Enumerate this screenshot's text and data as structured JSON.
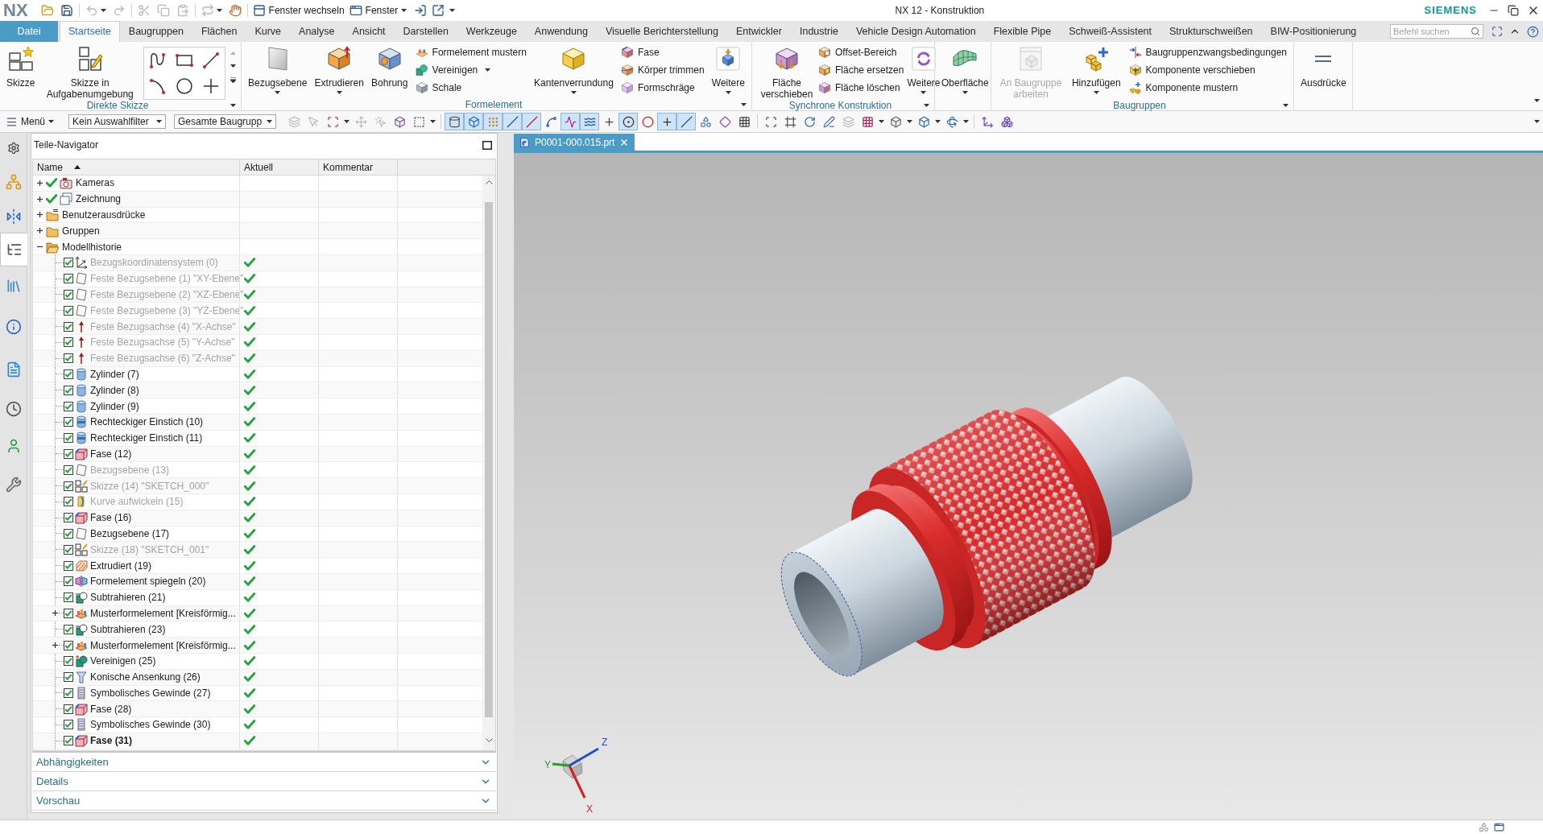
{
  "title_bar": {
    "logo": "NX",
    "quick_access": [
      {
        "disabled": false,
        "dropdown": false
      },
      {
        "disabled": false,
        "dropdown": false
      },
      {
        "disabled": true,
        "dropdown": true
      },
      {
        "disabled": true,
        "dropdown": false
      },
      {
        "disabled": true,
        "dropdown": false
      },
      {
        "disabled": true,
        "dropdown": false
      },
      {
        "disabled": true,
        "dropdown": false
      },
      {
        "disabled": true,
        "dropdown": true
      },
      {
        "disabled": false,
        "dropdown": false
      }
    ],
    "window_commands": [
      {
        "label": "Fenster wechseln",
        "dropdown": false
      },
      {
        "label": "Fenster",
        "dropdown": true
      }
    ],
    "title": "NX 12 - Konstruktion",
    "brand": "SIEMENS"
  },
  "menu_tabs": [
    {
      "label": "Datei",
      "kind": "file",
      "selected": false
    },
    {
      "label": "Startseite",
      "kind": "tab",
      "selected": true
    },
    {
      "label": "Baugruppen",
      "kind": "tab",
      "selected": false
    },
    {
      "label": "Flächen",
      "kind": "tab",
      "selected": false
    },
    {
      "label": "Kurve",
      "kind": "tab",
      "selected": false
    },
    {
      "label": "Analyse",
      "kind": "tab",
      "selected": false
    },
    {
      "label": "Ansicht",
      "kind": "tab",
      "selected": false
    },
    {
      "label": "Darstellen",
      "kind": "tab",
      "selected": false
    },
    {
      "label": "Werkzeuge",
      "kind": "tab",
      "selected": false
    },
    {
      "label": "Anwendung",
      "kind": "tab",
      "selected": false
    },
    {
      "label": "Visuelle Berichterstellung",
      "kind": "tab",
      "selected": false
    },
    {
      "label": "Entwickler",
      "kind": "tab",
      "selected": false
    },
    {
      "label": "Industrie",
      "kind": "tab",
      "selected": false
    },
    {
      "label": "Vehicle Design Automation",
      "kind": "tab",
      "selected": false
    },
    {
      "label": "Flexible Pipe",
      "kind": "tab",
      "selected": false
    },
    {
      "label": "Schweiß-Assistent",
      "kind": "tab",
      "selected": false
    },
    {
      "label": "Strukturschweißen",
      "kind": "tab",
      "selected": false
    },
    {
      "label": "BIW-Positionierung",
      "kind": "tab",
      "selected": false
    }
  ],
  "command_search": {
    "placeholder": "Befehl suchen"
  },
  "ribbon": {
    "groups": [
      {
        "label": "Direkte Skizze",
        "launcher": true,
        "items": [
          {
            "kind": "large",
            "label": "Skizze",
            "dropdown": false,
            "disabled": false
          },
          {
            "kind": "large",
            "label": "Skizze in Aufgabenumgebung",
            "dropdown": false,
            "disabled": false
          },
          {
            "kind": "gallery"
          }
        ]
      },
      {
        "label": "Formelement",
        "launcher": true,
        "items": [
          {
            "kind": "large",
            "label": "Bezugsebene",
            "dropdown": true,
            "disabled": false
          },
          {
            "kind": "large",
            "label": "Extrudieren",
            "dropdown": true,
            "disabled": false
          },
          {
            "kind": "large",
            "label": "Bohrung",
            "dropdown": false,
            "disabled": false
          },
          {
            "kind": "stack",
            "items": [
              {
                "label": "Formelement mustern",
                "dropdown": false
              },
              {
                "label": "Vereinigen",
                "dropdown": true
              },
              {
                "label": "Schale",
                "dropdown": false
              }
            ]
          },
          {
            "kind": "large",
            "label": "Kantenverrundung",
            "dropdown": true,
            "disabled": false
          },
          {
            "kind": "stack",
            "items": [
              {
                "label": "Fase",
                "dropdown": false
              },
              {
                "label": "Körper trimmen",
                "dropdown": false
              },
              {
                "label": "Formschräge",
                "dropdown": false
              }
            ]
          },
          {
            "kind": "large",
            "label": "Weitere",
            "dropdown": true,
            "disabled": false
          }
        ]
      },
      {
        "label": "Synchrone Konstruktion",
        "launcher": true,
        "items": [
          {
            "kind": "large",
            "label": "Fläche verschieben",
            "dropdown": false,
            "disabled": false
          },
          {
            "kind": "stack",
            "items": [
              {
                "label": "Offset-Bereich",
                "dropdown": false
              },
              {
                "label": "Fläche ersetzen",
                "dropdown": false
              },
              {
                "label": "Fläche löschen",
                "dropdown": false
              }
            ]
          },
          {
            "kind": "large",
            "label": "Weitere",
            "dropdown": true,
            "disabled": false
          }
        ]
      },
      {
        "launcher": false,
        "items": [
          {
            "kind": "large",
            "label": "Oberfläche",
            "dropdown": true,
            "disabled": false
          }
        ]
      },
      {
        "label": "Baugruppen",
        "launcher": true,
        "items": [
          {
            "kind": "large",
            "label": "An Baugruppe arbeiten",
            "dropdown": false,
            "disabled": true
          },
          {
            "kind": "large",
            "label": "Hinzufügen",
            "dropdown": true,
            "disabled": false
          },
          {
            "kind": "stack",
            "items": [
              {
                "label": "Baugruppenzwangsbedingungen",
                "dropdown": false
              },
              {
                "label": "Komponente verschieben",
                "dropdown": false
              },
              {
                "label": "Komponente mustern",
                "dropdown": false
              }
            ]
          }
        ]
      },
      {
        "launcher": false,
        "items": [
          {
            "kind": "large",
            "label": "Ausdrücke",
            "dropdown": false,
            "disabled": false
          }
        ]
      }
    ]
  },
  "toolbar": {
    "menu_label": "Menü",
    "filters": [
      "Kein Auswahlfilter",
      "Gesamte Baugrupp"
    ],
    "tools": [
      {
        "pressed": false,
        "disabled": true,
        "dropdown": false
      },
      {
        "pressed": false,
        "disabled": true,
        "dropdown": false
      },
      {
        "pressed": false,
        "disabled": false,
        "dropdown": true
      },
      {
        "pressed": false,
        "disabled": true,
        "dropdown": false
      },
      {
        "pressed": false,
        "disabled": true,
        "dropdown": false
      },
      {
        "pressed": false,
        "disabled": false,
        "dropdown": false
      },
      {
        "pressed": false,
        "disabled": false,
        "dropdown": true
      },
      {
        "pressed": true,
        "disabled": false,
        "dropdown": false
      },
      {
        "pressed": true,
        "disabled": false,
        "dropdown": false
      },
      {
        "pressed": true,
        "disabled": false,
        "dropdown": false
      },
      {
        "pressed": true,
        "disabled": false,
        "dropdown": false
      },
      {
        "pressed": true,
        "disabled": false,
        "dropdown": false
      },
      {
        "pressed": false,
        "disabled": false,
        "dropdown": false
      },
      {
        "pressed": true,
        "disabled": false,
        "dropdown": false
      },
      {
        "pressed": true,
        "disabled": false,
        "dropdown": false
      },
      {
        "pressed": false,
        "disabled": false,
        "dropdown": false
      },
      {
        "pressed": true,
        "disabled": false,
        "dropdown": false
      },
      {
        "pressed": false,
        "disabled": false,
        "dropdown": false
      },
      {
        "pressed": true,
        "disabled": false,
        "dropdown": false
      },
      {
        "pressed": true,
        "disabled": false,
        "dropdown": false
      },
      {
        "pressed": false,
        "disabled": false,
        "dropdown": false
      },
      {
        "pressed": false,
        "disabled": false,
        "dropdown": false
      },
      {
        "pressed": false,
        "disabled": false,
        "dropdown": false
      },
      {
        "pressed": false,
        "disabled": false,
        "dropdown": false
      },
      {
        "pressed": false,
        "disabled": false,
        "dropdown": false
      },
      {
        "pressed": false,
        "disabled": false,
        "dropdown": false
      },
      {
        "pressed": false,
        "disabled": false,
        "dropdown": false
      },
      {
        "pressed": false,
        "disabled": true,
        "dropdown": false
      },
      {
        "pressed": false,
        "disabled": false,
        "dropdown": true
      },
      {
        "pressed": false,
        "disabled": false,
        "dropdown": true
      },
      {
        "pressed": false,
        "disabled": false,
        "dropdown": true
      },
      {
        "pressed": false,
        "disabled": false,
        "dropdown": true
      },
      {
        "pressed": false,
        "disabled": false,
        "dropdown": false
      },
      {
        "pressed": false,
        "disabled": false,
        "dropdown": false
      }
    ]
  },
  "resource_bar": [
    {
      "selected": false
    },
    {
      "selected": false
    },
    {
      "selected": true
    },
    {
      "selected": false
    },
    {
      "selected": false
    },
    {
      "selected": false
    },
    {
      "selected": false
    },
    {
      "selected": false
    },
    {
      "selected": false
    }
  ],
  "navigator": {
    "title": "Teile-Navigator",
    "columns": [
      {
        "label": "Name",
        "sorted": true
      },
      {
        "label": "Aktuell",
        "sorted": false
      },
      {
        "label": "Kommentar",
        "sorted": false
      }
    ],
    "tree": [
      {
        "label": "Kameras",
        "checked": true,
        "expanded": false
      },
      {
        "label": "Zeichnung",
        "checked": true,
        "expanded": false
      },
      {
        "label": "Benutzerausdrücke",
        "checked": false,
        "expanded": false
      },
      {
        "label": "Gruppen",
        "checked": false,
        "expanded": false
      },
      {
        "label": "Modellhistorie",
        "checked": false,
        "expanded": true,
        "children": [
          {
            "label": "Bezugskoordinatensystem (0)",
            "checked": true,
            "hidden": true,
            "current": false,
            "collapsed": false,
            "up_to_date": true
          },
          {
            "label": "Feste Bezugsebene (1) \"XY-Ebene\"",
            "checked": true,
            "hidden": true,
            "current": false,
            "collapsed": false,
            "up_to_date": true
          },
          {
            "label": "Feste Bezugsebene (2) \"XZ-Ebene\"",
            "checked": true,
            "hidden": true,
            "current": false,
            "collapsed": false,
            "up_to_date": true
          },
          {
            "label": "Feste Bezugsebene (3) \"YZ-Ebene\"",
            "checked": true,
            "hidden": true,
            "current": false,
            "collapsed": false,
            "up_to_date": true
          },
          {
            "label": "Feste Bezugsachse (4) \"X-Achse\"",
            "checked": true,
            "hidden": true,
            "current": false,
            "collapsed": false,
            "up_to_date": true
          },
          {
            "label": "Feste Bezugsachse (5) \"Y-Achse\"",
            "checked": true,
            "hidden": true,
            "current": false,
            "collapsed": false,
            "up_to_date": true
          },
          {
            "label": "Feste Bezugsachse (6) \"Z-Achse\"",
            "checked": true,
            "hidden": true,
            "current": false,
            "collapsed": false,
            "up_to_date": true
          },
          {
            "label": "Zylinder (7)",
            "checked": true,
            "hidden": false,
            "current": false,
            "collapsed": false,
            "up_to_date": true
          },
          {
            "label": "Zylinder (8)",
            "checked": true,
            "hidden": false,
            "current": false,
            "collapsed": false,
            "up_to_date": true
          },
          {
            "label": "Zylinder (9)",
            "checked": true,
            "hidden": false,
            "current": false,
            "collapsed": false,
            "up_to_date": true
          },
          {
            "label": "Rechteckiger Einstich (10)",
            "checked": true,
            "hidden": false,
            "current": false,
            "collapsed": false,
            "up_to_date": true
          },
          {
            "label": "Rechteckiger Einstich (11)",
            "checked": true,
            "hidden": false,
            "current": false,
            "collapsed": false,
            "up_to_date": true
          },
          {
            "label": "Fase (12)",
            "checked": true,
            "hidden": false,
            "current": false,
            "collapsed": false,
            "up_to_date": true
          },
          {
            "label": "Bezugsebene (13)",
            "checked": true,
            "hidden": true,
            "current": false,
            "collapsed": false,
            "up_to_date": true
          },
          {
            "label": "Skizze (14) \"SKETCH_000\"",
            "checked": true,
            "hidden": true,
            "current": false,
            "collapsed": false,
            "up_to_date": true
          },
          {
            "label": "Kurve aufwickeln (15)",
            "checked": true,
            "hidden": true,
            "current": false,
            "collapsed": false,
            "up_to_date": true
          },
          {
            "label": "Fase (16)",
            "checked": true,
            "hidden": false,
            "current": false,
            "collapsed": false,
            "up_to_date": true
          },
          {
            "label": "Bezugsebene (17)",
            "checked": true,
            "hidden": false,
            "current": false,
            "collapsed": false,
            "up_to_date": true
          },
          {
            "label": "Skizze (18) \"SKETCH_001\"",
            "checked": true,
            "hidden": true,
            "current": false,
            "collapsed": false,
            "up_to_date": true
          },
          {
            "label": "Extrudiert (19)",
            "checked": true,
            "hidden": false,
            "current": false,
            "collapsed": false,
            "up_to_date": true
          },
          {
            "label": "Formelement spiegeln (20)",
            "checked": true,
            "hidden": false,
            "current": false,
            "collapsed": false,
            "up_to_date": true
          },
          {
            "label": "Subtrahieren (21)",
            "checked": true,
            "hidden": false,
            "current": false,
            "collapsed": false,
            "up_to_date": true
          },
          {
            "label": "Musterformelement [Kreisförmig...",
            "checked": true,
            "hidden": false,
            "current": false,
            "collapsed": true,
            "up_to_date": true
          },
          {
            "label": "Subtrahieren (23)",
            "checked": true,
            "hidden": false,
            "current": false,
            "collapsed": false,
            "up_to_date": true
          },
          {
            "label": "Musterformelement [Kreisförmig...",
            "checked": true,
            "hidden": false,
            "current": false,
            "collapsed": true,
            "up_to_date": true
          },
          {
            "label": "Vereinigen (25)",
            "checked": true,
            "hidden": false,
            "current": false,
            "collapsed": false,
            "up_to_date": true
          },
          {
            "label": "Konische Ansenkung (26)",
            "checked": true,
            "hidden": false,
            "current": false,
            "collapsed": false,
            "up_to_date": true
          },
          {
            "label": "Symbolisches Gewinde (27)",
            "checked": true,
            "hidden": false,
            "current": false,
            "collapsed": false,
            "up_to_date": true
          },
          {
            "label": "Fase (28)",
            "checked": true,
            "hidden": false,
            "current": false,
            "collapsed": false,
            "up_to_date": true
          },
          {
            "label": "Symbolisches Gewinde (30)",
            "checked": true,
            "hidden": false,
            "current": false,
            "collapsed": false,
            "up_to_date": true
          },
          {
            "label": "Fase (31)",
            "checked": true,
            "hidden": false,
            "current": true,
            "collapsed": false,
            "up_to_date": true
          }
        ]
      }
    ],
    "sections": [
      {
        "label": "Abhängigkeiten",
        "expanded": false
      },
      {
        "label": "Details",
        "expanded": false
      },
      {
        "label": "Vorschau",
        "expanded": false
      }
    ]
  },
  "document_tabs": [
    {
      "label": "P0001-000.015.prt",
      "selected": true
    }
  ],
  "view_triad": {
    "axes": [
      {
        "label": "X",
        "color": "#d42020"
      },
      {
        "label": "Y",
        "color": "#2a9a2a"
      },
      {
        "label": "Z",
        "color": "#2050d0"
      }
    ]
  }
}
